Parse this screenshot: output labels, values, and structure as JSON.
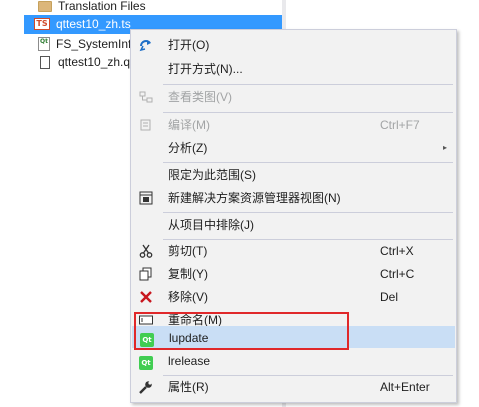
{
  "tree": {
    "folder_label": "Translation Files",
    "selected_file": "qttest10_zh.ts",
    "ts_badge": "TS",
    "file3": "FS_SystemInf",
    "file3_badge": "Qt",
    "file4": "qttest10_zh.q"
  },
  "menu": {
    "open": {
      "label": "打开(O)",
      "icon": "open-arrow-icon"
    },
    "open_with": {
      "label": "打开方式(N)..."
    },
    "view_class": {
      "label": "查看类图(V)",
      "disabled": true
    },
    "compile": {
      "label": "编译(M)",
      "shortcut": "Ctrl+F7",
      "disabled": true
    },
    "analyze": {
      "label": "分析(Z)",
      "submenu_arrow": "▸"
    },
    "scope": {
      "label": "限定为此范围(S)"
    },
    "new_view": {
      "label": "新建解决方案资源管理器视图(N)"
    },
    "exclude": {
      "label": "从项目中排除(J)"
    },
    "cut": {
      "label": "剪切(T)",
      "shortcut": "Ctrl+X"
    },
    "copy": {
      "label": "复制(Y)",
      "shortcut": "Ctrl+C"
    },
    "remove": {
      "label": "移除(V)",
      "shortcut": "Del"
    },
    "rename": {
      "label": "重命名(M)"
    },
    "lupdate": {
      "label": "lupdate",
      "badge": "Qt"
    },
    "lrelease": {
      "label": "lrelease",
      "badge": "Qt"
    },
    "properties": {
      "label": "属性(R)",
      "shortcut": "Alt+Enter"
    }
  },
  "colors": {
    "selection": "#3399ff",
    "menu_bg": "#f2f2f2",
    "hover": "#c9def5",
    "highlight_box": "#e0282a",
    "qt_green": "#41cd52"
  }
}
